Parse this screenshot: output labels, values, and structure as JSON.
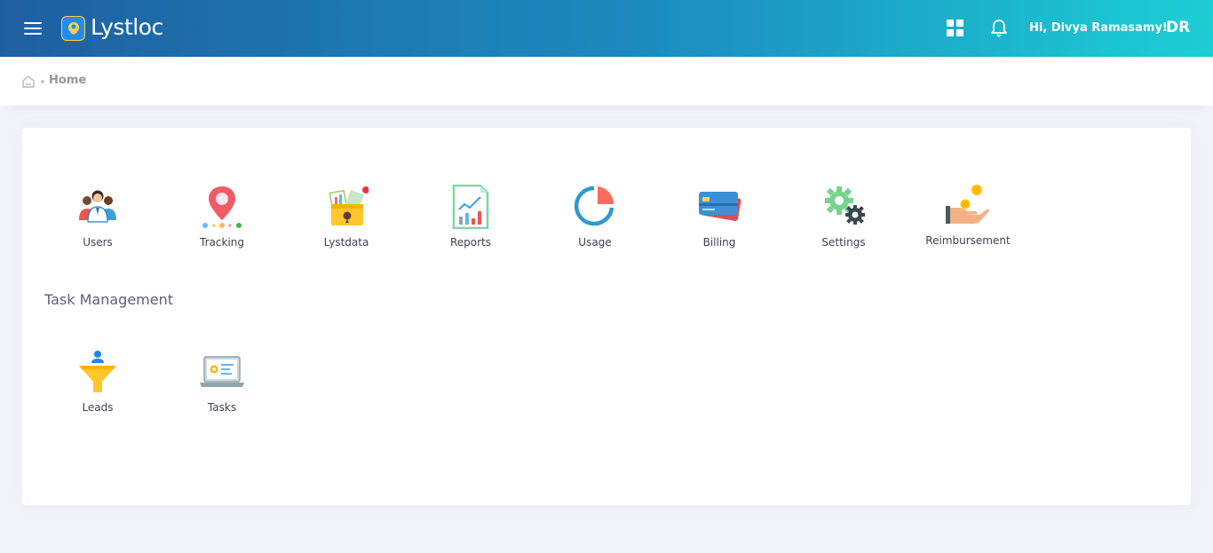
{
  "header": {
    "app_name": "Lystloc",
    "greeting": "Hi, Divya Ramasamy!",
    "user_initials": "DR",
    "menu_icon": "hamburger-menu-icon",
    "apps_icon": "apps-grid-icon",
    "notifications_icon": "bell-icon"
  },
  "breadcrumb": {
    "home_icon": "home-icon",
    "current": "Home"
  },
  "modules": [
    {
      "label": "Users",
      "icon": "users-icon"
    },
    {
      "label": "Tracking",
      "icon": "location-pin-icon"
    },
    {
      "label": "Lystdata",
      "icon": "folder-data-icon"
    },
    {
      "label": "Reports",
      "icon": "report-chart-icon"
    },
    {
      "label": "Usage",
      "icon": "pie-chart-icon"
    },
    {
      "label": "Billing",
      "icon": "credit-card-icon"
    },
    {
      "label": "Settings",
      "icon": "gears-icon"
    },
    {
      "label": "Reimbursement",
      "icon": "hand-coins-icon"
    }
  ],
  "task_management": {
    "title": "Task Management",
    "items": [
      {
        "label": "Leads",
        "icon": "funnel-icon"
      },
      {
        "label": "Tasks",
        "icon": "laptop-task-icon"
      }
    ]
  },
  "colors": {
    "header_gradient_start": "#1e5fa0",
    "header_gradient_end": "#1ccfd4",
    "page_background": "#f2f3f8",
    "card_background": "#ffffff"
  }
}
